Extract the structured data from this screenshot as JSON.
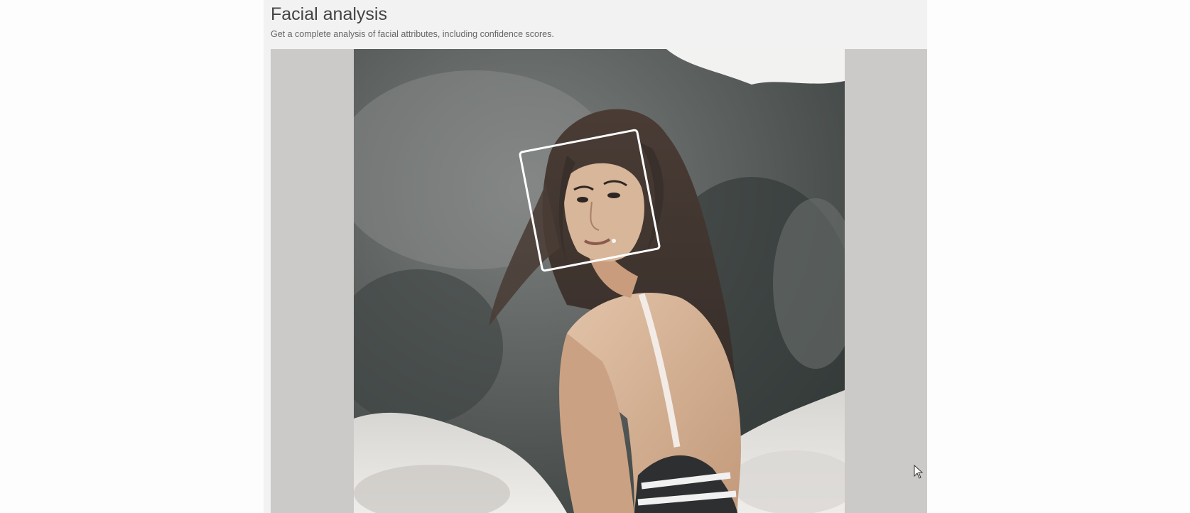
{
  "page": {
    "title": "Facial analysis",
    "subtitle": "Get a complete analysis of facial attributes, including confidence scores."
  },
  "image": {
    "alt": "woman on rocks looking over her shoulder",
    "detected_faces": 1
  },
  "colors": {
    "panel_bg": "#f2f2f2",
    "stage_bg": "#cbcac8",
    "face_box": "#ffffff",
    "skin": "#c8a486",
    "hair": "#3e3531"
  }
}
